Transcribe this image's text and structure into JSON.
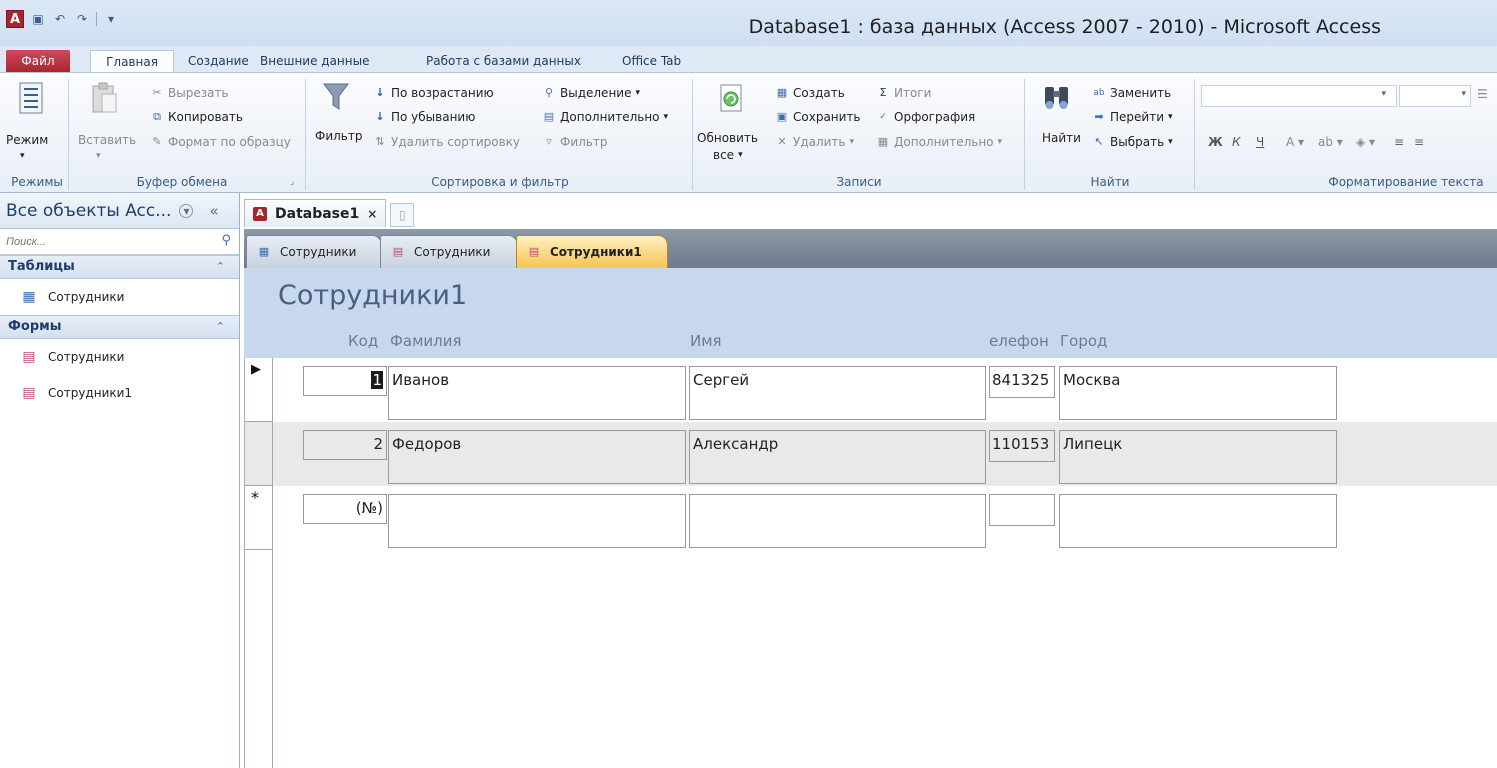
{
  "window": {
    "title": "Database1 : база данных (Access 2007 - 2010)  -  Microsoft Access",
    "app_icon": "A"
  },
  "ribbon_tabs": [
    "Файл",
    "Главная",
    "Создание",
    "Внешние данные",
    "Работа с базами данных",
    "Office Tab"
  ],
  "ribbon": {
    "views": {
      "button": "Режим",
      "group": "Режимы"
    },
    "clipboard": {
      "paste": "Вставить",
      "cut": "Вырезать",
      "copy": "Копировать",
      "format_painter": "Формат по образцу",
      "group": "Буфер обмена"
    },
    "sort_filter": {
      "filter": "Фильтр",
      "ascending": "По возрастанию",
      "descending": "По убыванию",
      "remove_sort": "Удалить сортировку",
      "selection": "Выделение",
      "advanced": "Дополнительно",
      "toggle_filter": "Фильтр",
      "group": "Сортировка и фильтр"
    },
    "records": {
      "refresh": "Обновить",
      "refresh2": "все",
      "new": "Создать",
      "save": "Сохранить",
      "delete": "Удалить",
      "totals": "Итоги",
      "spelling": "Орфография",
      "more": "Дополнительно",
      "group": "Записи"
    },
    "find": {
      "find": "Найти",
      "replace": "Заменить",
      "goto": "Перейти",
      "select": "Выбрать",
      "group": "Найти"
    },
    "text_format": {
      "group": "Форматирование текста",
      "bold": "Ж",
      "italic": "К",
      "underline": "Ч"
    }
  },
  "nav": {
    "header": "Все объекты Acc...",
    "search_placeholder": "Поиск...",
    "sections": [
      {
        "title": "Таблицы",
        "items": [
          "Сотрудники"
        ]
      },
      {
        "title": "Формы",
        "items": [
          "Сотрудники",
          "Сотрудники1"
        ]
      }
    ]
  },
  "document": {
    "db_tab": "Database1",
    "tabs": [
      "Сотрудники",
      "Сотрудники",
      "Сотрудники1"
    ],
    "active_tab": 2
  },
  "form": {
    "title": "Сотрудники1",
    "columns": {
      "code": "Код",
      "last_name": "Фамилия",
      "first_name": "Имя",
      "phone": "елефон",
      "city": "Город"
    },
    "records": [
      {
        "code": "1",
        "last_name": "Иванов",
        "first_name": "Сергей",
        "phone": "841325",
        "city": "Москва"
      },
      {
        "code": "2",
        "last_name": "Федоров",
        "first_name": "Александр",
        "phone": "110153",
        "city": "Липецк"
      }
    ],
    "new_record": {
      "code": "(№)"
    },
    "current_marker": "▶",
    "new_marker": "*"
  }
}
